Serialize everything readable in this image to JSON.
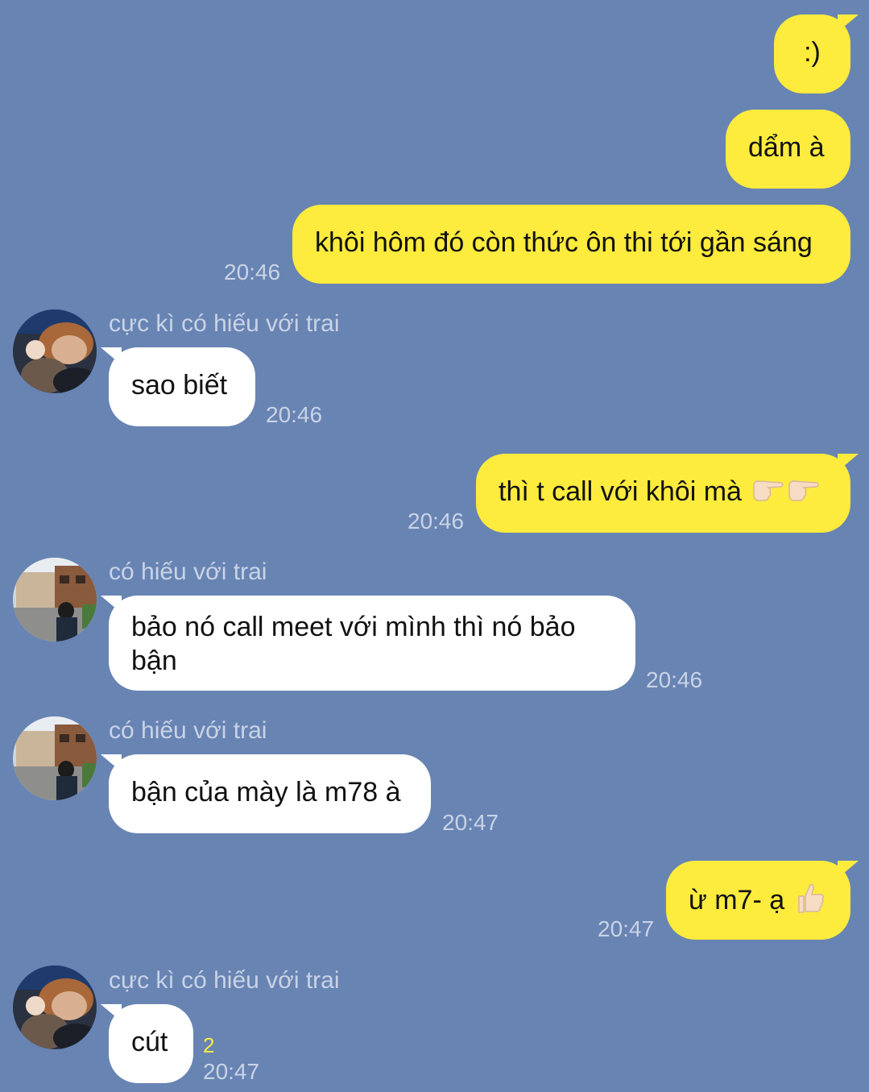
{
  "messages": [
    {
      "text": ":)"
    },
    {
      "text": "dẩm à"
    },
    {
      "text": "khôi hôm đó còn thức ôn thi tới gần sáng",
      "time": "20:46"
    },
    {
      "sender": "cực kì có hiếu với trai",
      "text": "sao biết",
      "time": "20:46"
    },
    {
      "text": "thì t call với khôi mà",
      "emoji": [
        "pointing-right-icon",
        "pointing-right-icon"
      ],
      "time": "20:46"
    },
    {
      "sender": "có hiếu với trai",
      "text": "bảo nó call meet với mình thì nó bảo bận",
      "time": "20:46"
    },
    {
      "sender": "có hiếu với trai",
      "text": "bận của mày là m78 à",
      "time": "20:47"
    },
    {
      "text": "ừ m7- ạ",
      "emoji": [
        "thumbs-up-icon"
      ],
      "time": "20:47"
    },
    {
      "sender": "cực kì có hiếu với trai",
      "text": "cút",
      "unread": "2",
      "time": "20:47"
    }
  ],
  "colors": {
    "background": "#6884b3",
    "outgoing_bubble": "#fdeb3d",
    "incoming_bubble": "#ffffff",
    "meta_text": "#c9d3e6",
    "unread_count": "#fdeb3d"
  }
}
